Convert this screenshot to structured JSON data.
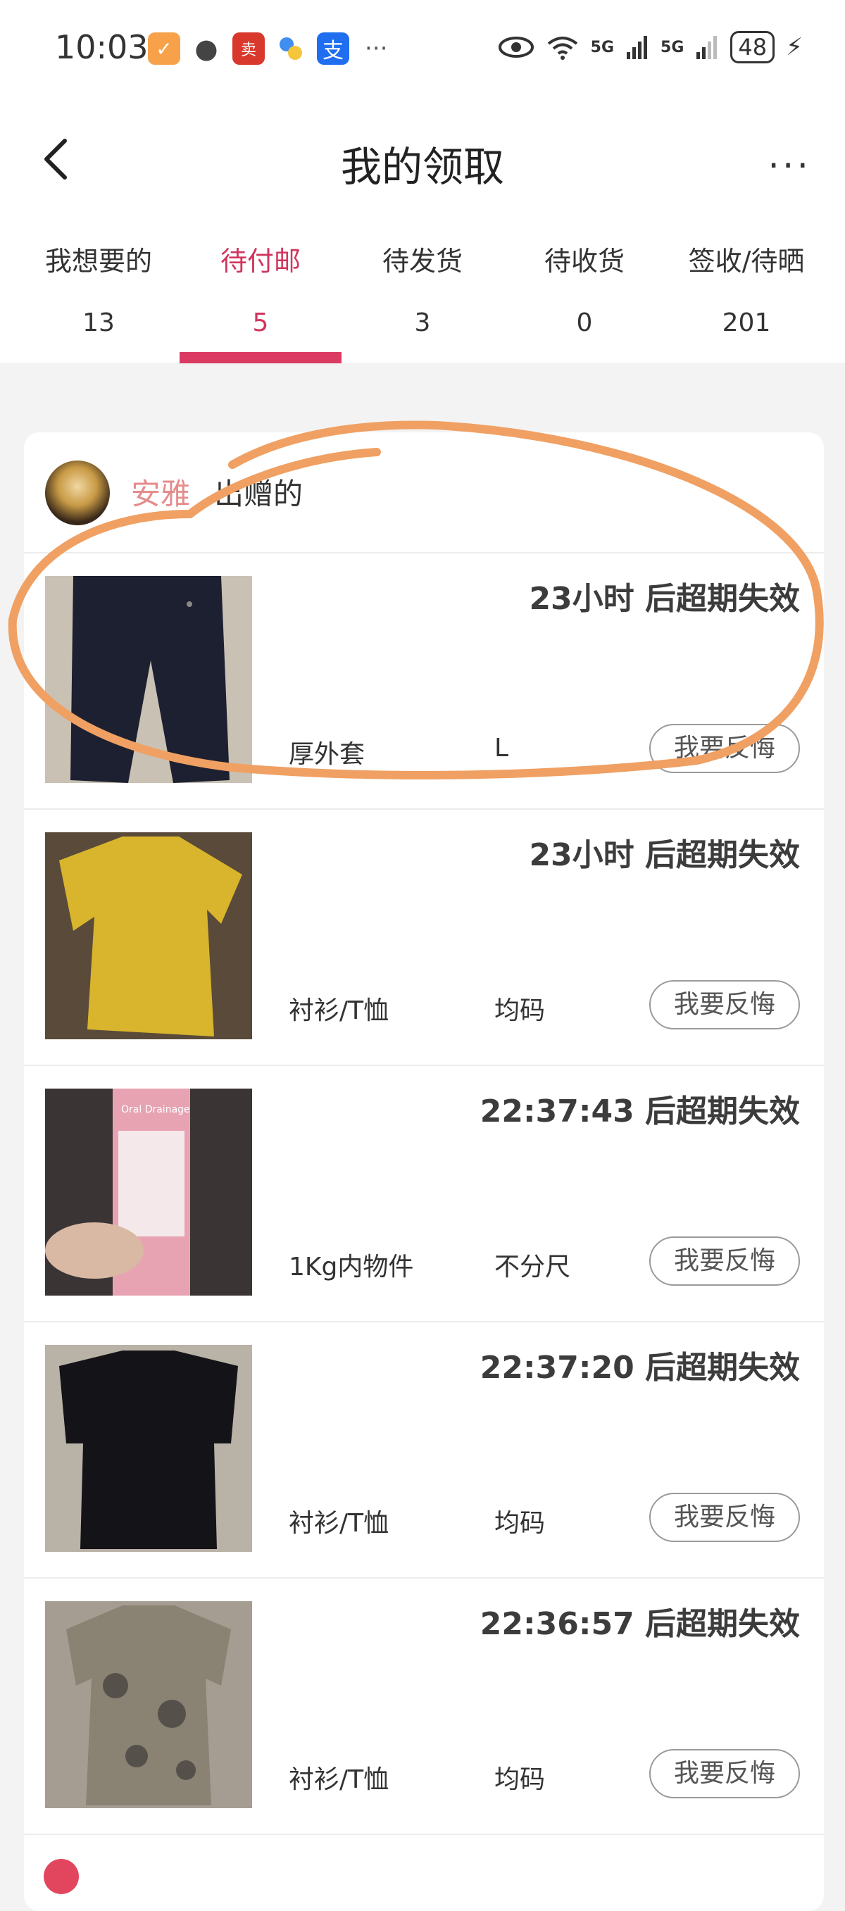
{
  "status_bar": {
    "time": "10:03",
    "battery": "48",
    "icons": [
      "taobao-icon",
      "wechat-icon",
      "eleme-icon",
      "app-icon",
      "alipay-icon",
      "eye-icon",
      "wifi-icon",
      "signal-5g-icon",
      "signal-5g-icon",
      "charging-icon"
    ],
    "more_dots": "···",
    "net1": "5G",
    "net2": "5G"
  },
  "header": {
    "title": "我的领取",
    "more": "···"
  },
  "tabs": [
    {
      "label": "我想要的",
      "count": "13",
      "active": false
    },
    {
      "label": "待付邮",
      "count": "5",
      "active": true
    },
    {
      "label": "待发货",
      "count": "3",
      "active": false
    },
    {
      "label": "待收货",
      "count": "0",
      "active": false
    },
    {
      "label": "签收/待晒",
      "count": "201",
      "active": false
    }
  ],
  "giver": {
    "name": "安雅",
    "suffix": "出赠的"
  },
  "items": [
    {
      "timer": "23小时 后超期失效",
      "category": "厚外套",
      "size": "L",
      "button": "我要反悔",
      "photo": "pants"
    },
    {
      "timer": "23小时 后超期失效",
      "category": "衬衫/T恤",
      "size": "均码",
      "button": "我要反悔",
      "photo": "yellow-shirt"
    },
    {
      "timer": "22:37:43 后超期失效",
      "category": "1Kg内物件",
      "size": "不分尺",
      "button": "我要反悔",
      "photo": "oral-box"
    },
    {
      "timer": "22:37:20 后超期失效",
      "category": "衬衫/T恤",
      "size": "均码",
      "button": "我要反悔",
      "photo": "black-blouse"
    },
    {
      "timer": "22:36:57 后超期失效",
      "category": "衬衫/T恤",
      "size": "均码",
      "button": "我要反悔",
      "photo": "mesh-top"
    }
  ],
  "photo_text": {
    "oral_box_label": "Oral Drainage"
  },
  "colors": {
    "accent": "#db3a63",
    "annotation": "#f0a062"
  }
}
